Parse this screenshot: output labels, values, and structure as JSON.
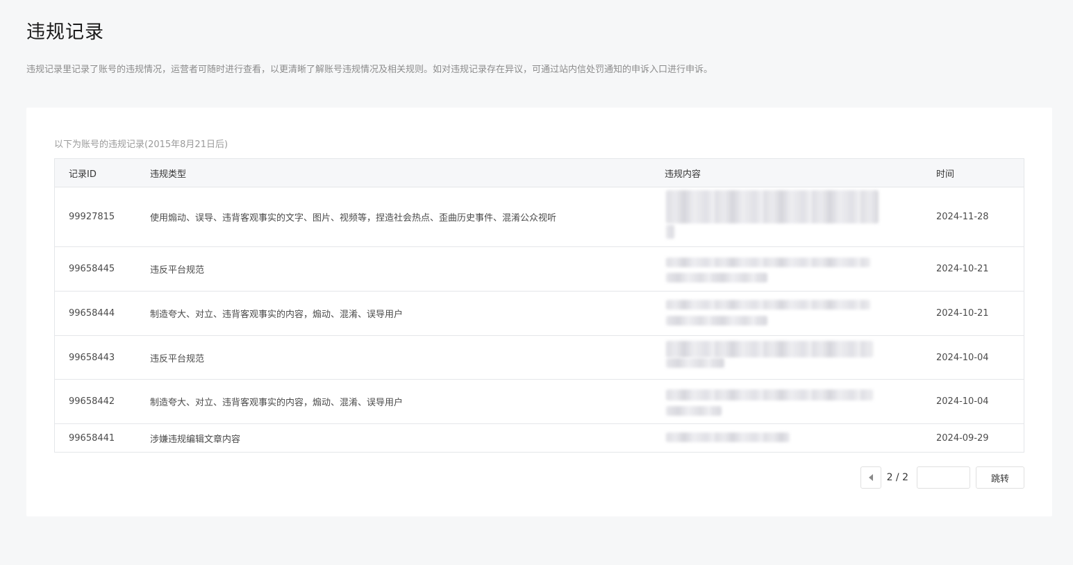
{
  "page": {
    "title": "违规记录",
    "description": "违规记录里记录了账号的违规情况，运营者可随时进行查看，以更清晰了解账号违规情况及相关规则。如对违规记录存在异议，可通过站内信处罚通知的申诉入口进行申诉。"
  },
  "records": {
    "note": "以下为账号的违规记录(2015年8月21日后)",
    "columns": [
      "记录ID",
      "违规类型",
      "违规内容",
      "时间"
    ],
    "rows": [
      {
        "id": "99927815",
        "type": "使用煽动、误导、违背客观事实的文字、图片、视频等，捏造社会热点、歪曲历史事件、混淆公众视听",
        "content": "",
        "time": "2024-11-28"
      },
      {
        "id": "99658445",
        "type": "违反平台规范",
        "content": "",
        "time": "2024-10-21"
      },
      {
        "id": "99658444",
        "type": "制造夸大、对立、违背客观事实的内容，煽动、混淆、误导用户",
        "content": "",
        "time": "2024-10-21"
      },
      {
        "id": "99658443",
        "type": "违反平台规范",
        "content": "",
        "time": "2024-10-04"
      },
      {
        "id": "99658442",
        "type": "制造夸大、对立、违背客观事实的内容，煽动、混淆、误导用户",
        "content": "",
        "time": "2024-10-04"
      },
      {
        "id": "99658441",
        "type": "涉嫌违规编辑文章内容",
        "content": "",
        "time": "2024-09-29"
      }
    ]
  },
  "pagination": {
    "current": "2 / 2",
    "jump_input_value": "",
    "jump_label": "跳转"
  }
}
